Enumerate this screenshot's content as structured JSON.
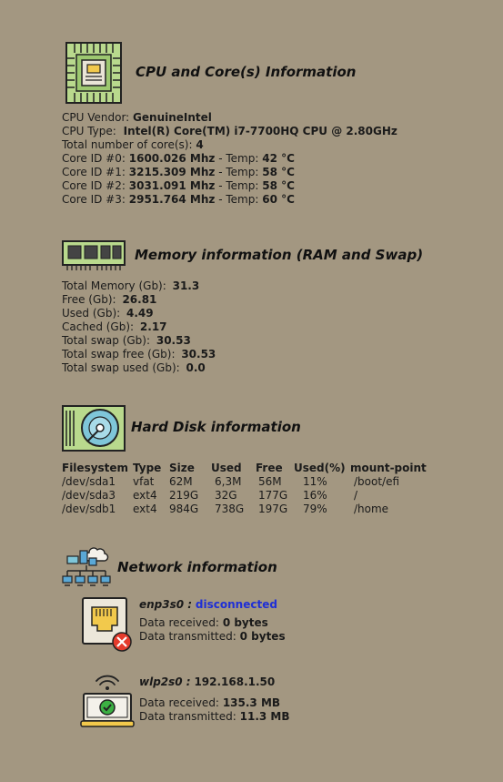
{
  "cpu": {
    "title": "CPU and Core(s) Information",
    "icon": "cpu-chip-icon",
    "vendor_label": "CPU Vendor:",
    "vendor_value": "GenuineIntel",
    "type_label": "CPU Type:",
    "type_value": "Intel(R) Core(TM) i7-7700HQ CPU @ 2.80GHz",
    "cores_label": "Total number of core(s):",
    "cores_value": "4",
    "temp_label": "- Temp:",
    "core_list": [
      {
        "label": "Core ID #0:",
        "freq": "1600.026 Mhz",
        "temp": "42 °C"
      },
      {
        "label": "Core ID #1:",
        "freq": "3215.309 Mhz",
        "temp": "58 °C"
      },
      {
        "label": "Core ID #2:",
        "freq": "3031.091 Mhz",
        "temp": "58 °C"
      },
      {
        "label": "Core ID #3:",
        "freq": "2951.764 Mhz",
        "temp": "60 °C"
      }
    ]
  },
  "memory": {
    "title": "Memory information (RAM and Swap)",
    "icon": "ram-module-icon",
    "rows": [
      {
        "label": "Total Memory (Gb):",
        "value": "31.3"
      },
      {
        "label": "Free (Gb):",
        "value": "26.81"
      },
      {
        "label": "Used (Gb):",
        "value": "4.49"
      },
      {
        "label": "Cached (Gb):",
        "value": "2.17"
      },
      {
        "label": "Total swap (Gb):",
        "value": "30.53"
      },
      {
        "label": "Total swap free (Gb):",
        "value": "30.53"
      },
      {
        "label": "Total swap used (Gb):",
        "value": "0.0"
      }
    ]
  },
  "disk": {
    "title": "Hard Disk information",
    "icon": "hard-disk-icon",
    "headers": [
      "Filesystem",
      "Type",
      "Size",
      "Used",
      "Free",
      "Used(%)",
      "mount-point"
    ],
    "rows": [
      [
        "/dev/sda1",
        "vfat",
        "62M",
        "6,3M",
        "56M",
        "11%",
        "/boot/efi"
      ],
      [
        "/dev/sda3",
        "ext4",
        "219G",
        "32G",
        "177G",
        "16%",
        "/"
      ],
      [
        "/dev/sdb1",
        "ext4",
        "984G",
        "738G",
        "197G",
        "79%",
        "/home"
      ]
    ]
  },
  "network": {
    "title": "Network information",
    "icon": "network-topology-icon",
    "interfaces": [
      {
        "name": "enp3s0 :",
        "status": "disconnected",
        "icon": "ethernet-port-disconnected-icon",
        "received_label": "Data received:",
        "received_value": "0 bytes",
        "transmitted_label": "Data transmitted:",
        "transmitted_value": "0 bytes"
      },
      {
        "name": "wlp2s0 :",
        "status": "192.168.1.50",
        "icon": "wifi-laptop-connected-icon",
        "received_label": "Data received:",
        "received_value": "135.3 MB",
        "transmitted_label": "Data transmitted:",
        "transmitted_value": "11.3 MB"
      }
    ]
  },
  "colors": {
    "background": "#a39781",
    "link_blue": "#1f2fd6",
    "icon_green": "#b5d98c"
  }
}
